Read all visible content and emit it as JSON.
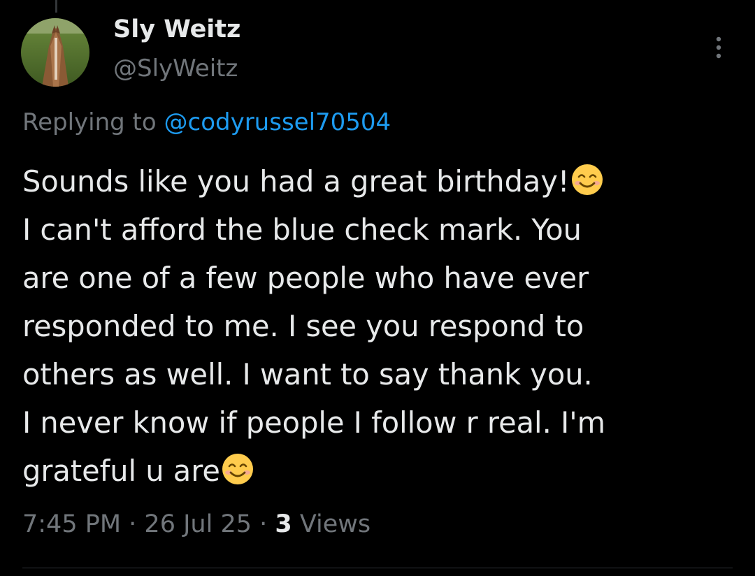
{
  "author": {
    "display_name": "Sly Weitz",
    "handle": "@SlyWeitz"
  },
  "reply": {
    "prefix": "Replying to ",
    "mention": "@codyrussel70504"
  },
  "tweet": {
    "lines": [
      "Sounds like you had a great birthday!",
      "I can't afford the blue check mark. You",
      "are one of a few people who have ever",
      "responded to me. I see you respond to",
      "others as well. I want to say thank you.",
      "I never know if people I follow r real. I'm",
      "grateful u are"
    ],
    "emoji": "smiling-face-with-smiling-eyes"
  },
  "meta": {
    "time": "7:45 PM",
    "separator": " · ",
    "date": "26 Jul 25",
    "views_count": "3",
    "views_label": " Views"
  },
  "colors": {
    "background": "#000000",
    "text": "#e7e9ea",
    "secondary": "#71767b",
    "link": "#1d9bf0"
  }
}
